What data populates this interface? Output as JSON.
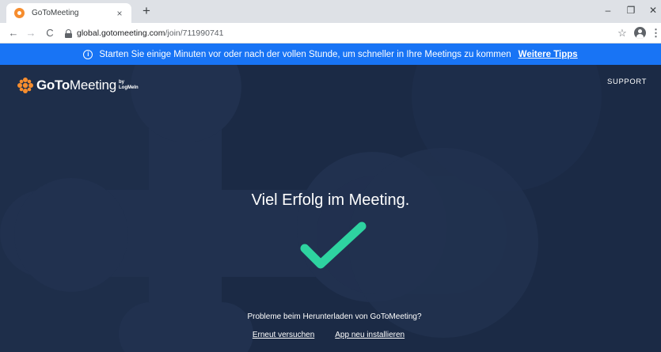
{
  "browser": {
    "tab_title": "GoToMeeting",
    "tab_close": "×",
    "new_tab": "+",
    "window_controls": {
      "minimize": "–",
      "restore": "❐",
      "close": "✕"
    },
    "nav": {
      "back": "←",
      "forward": "→",
      "reload": "C"
    },
    "url_host": "global.gotomeeting.com",
    "url_path": "/join/711990741",
    "star": "☆",
    "menu": "⋮",
    "icons": [
      "back-icon",
      "forward-icon",
      "reload-icon",
      "lock-icon",
      "star-icon",
      "profile-icon",
      "menu-icon"
    ]
  },
  "banner": {
    "icon": "i",
    "text": "Starten Sie einige Minuten vor oder nach der vollen Stunde, um schneller in Ihre Meetings zu kommen",
    "link": "Weitere Tipps",
    "color": "#1874f5"
  },
  "header": {
    "logo_goto": "GoTo",
    "logo_meeting": "Meeting",
    "logo_by": "by",
    "logo_logmein": "LogMeIn",
    "support": "SUPPORT"
  },
  "main": {
    "headline": "Viel Erfolg im Meeting.",
    "check_color": "#2ed3a0",
    "problem_text": "Probleme beim Herunterladen von GoToMeeting?",
    "retry_link": "Erneut versuchen",
    "reinstall_link": "App neu installieren"
  },
  "colors": {
    "page_bg": "#1b2a45",
    "logo_accent": "#f68d2e"
  }
}
